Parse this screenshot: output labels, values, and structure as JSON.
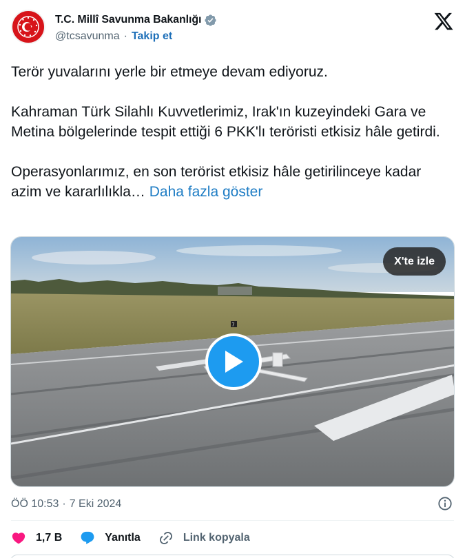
{
  "author": {
    "display_name": "T.C. Millî Savunma Bakanlığı",
    "handle": "@tcsavunma",
    "separator": "·",
    "follow_label": "Takip et",
    "verified_color": "#829aab"
  },
  "tweet": {
    "paragraph_1": "Terör yuvalarını yerle bir etmeye devam ediyoruz.",
    "paragraph_2": "Kahraman Türk Silahlı Kuvvetlerimiz, Irak'ın kuzeyindeki Gara ve Metina bölgelerinde tespit ettiği 6 PKK'lı teröristi etkisiz hâle getirdi.",
    "paragraph_3": "Operasyonlarımız, en son terörist etkisiz hâle getirilinceye kadar azim ve kararlılıkla…",
    "show_more_label": "Daha fazla göster"
  },
  "media": {
    "watch_on_x_label": "X'te izle",
    "runway_marker": "7",
    "play_color": "#1d9bf0"
  },
  "meta": {
    "time": "ÖÖ 10:53",
    "separator": "·",
    "date": "7 Eki 2024"
  },
  "actions": {
    "like_count": "1,7 B",
    "like_color": "#f91880",
    "reply_label": "Yanıtla",
    "reply_color": "#1d9bf0",
    "copy_link_label": "Link kopyala"
  }
}
